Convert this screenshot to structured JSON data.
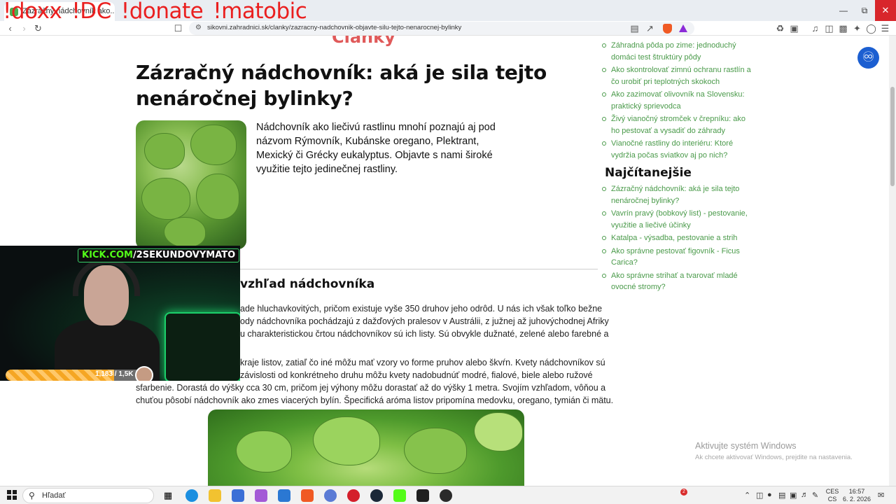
{
  "overlay": {
    "commands": [
      "!doxx",
      "!DC",
      "!donate",
      "!matobic"
    ]
  },
  "browser": {
    "tab_title": "Zázračný nádchovník ako...",
    "url": "sikovni.zahradnici.sk/clanky/zazracny-nadchovnik-objavte-silu-tejto-nenarocnej-bylinky",
    "accent_brave": "#f05a24"
  },
  "page": {
    "section_heading": "Články",
    "title": "Zázračný nádchovník: aká je sila tejto nenáročnej bylinky?",
    "intro": "Nádchovník ako liečivú rastlinu mnohí poznajú aj pod názvom Rýmovník, Kubánske oregano, Plektrant, Mexický či Grécky eukalyptus. Objavte s nami široké využitie tejto jedinečnej rastliny.",
    "subheading": "vzhľad nádchovníka",
    "paragraph_lines": [
      "ade hluchavkovitých, pričom existuje vyše 350 druhov jeho odrôd. U nás ich však toľko bežne",
      "ody nádchovníka pochádzajú z dažďových pralesov v Austrálii, z južnej až juhovýchodnej Afriky",
      "u charakteristickou črtou nádchovníkov sú ich listy. Sú obvykle dužnaté, zelené alebo farebné a",
      "",
      "kraje listov, zatiaľ čo iné môžu mať vzory vo forme pruhov alebo škvŕn. Kvety nádchovníkov sú",
      "závislosti od konkrétneho druhu môžu kvety nadobudnúť modré, fialové, biele alebo ružové",
      "sfarbenie. Dorastá do výšky cca 30 cm, pričom jej výhony môžu dorastať až do výšky 1 metra. Svojím vzhľadom, vôňou a",
      "chuťou pôsobí nádchovník ako zmes viacerých bylín. Špecifická aróma listov pripomína medovku, oregano, tymián či mätu."
    ]
  },
  "sidebar": {
    "latest": [
      "Záhradná pôda po zime: jednoduchý domáci test štruktúry pôdy",
      "Ako skontrolovať zimnú ochranu rastlín a čo urobiť pri teplotných skokoch",
      "Ako zazimovať olivovník na Slovensku: praktický sprievodca",
      "Živý vianočný stromček v črepníku: ako ho pestovať a vysadiť do záhrady",
      "Vianočné rastliny do interiéru: Ktoré vydržia počas sviatkov aj po nich?"
    ],
    "most_read_title": "Najčítanejšie",
    "most_read": [
      "Zázračný nádchovník: aká je sila tejto nenáročnej bylinky?",
      "Vavrín pravý (bobkový list) - pestovanie, využitie a liečivé účinky",
      "Katalpa - výsadba, pestovanie a strih",
      "Ako správne pestovať figovník - Ficus Carica?",
      "Ako správne strihať a tvarovať mladé ovocné stromy?"
    ]
  },
  "stream": {
    "kick_prefix": "KICK.COM",
    "kick_channel": "/2SEKUNDOVYMATO",
    "follower_goal": "1,183 / 1,5K",
    "follower_progress": 0.79
  },
  "windows": {
    "activate_title": "Aktivujte systém Windows",
    "activate_sub": "Ak chcete aktivovať Windows, prejdite na nastavenia."
  },
  "taskbar": {
    "search_placeholder": "Hľadať",
    "notif_count": "2",
    "lang_top": "CES",
    "lang_bottom": "CS",
    "time": "16:57",
    "date": "6. 2. 2026"
  }
}
